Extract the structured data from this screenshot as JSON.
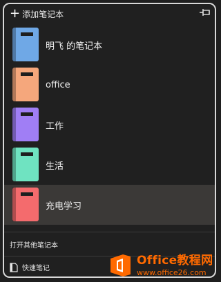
{
  "header": {
    "add_label": "添加笔记本"
  },
  "notebooks": [
    {
      "label": "明飞 的笔记本",
      "color": "#6fa8e6"
    },
    {
      "label": "office",
      "color": "#f5a77c"
    },
    {
      "label": "工作",
      "color": "#a07ef5"
    },
    {
      "label": "生活",
      "color": "#6fe3c1"
    },
    {
      "label": "充电学习",
      "color": "#f46b6d"
    }
  ],
  "selected_index": 4,
  "footer": {
    "open_other": "打开其他笔记本",
    "quick_notes": "快速笔记"
  },
  "watermark": {
    "main": "Office教程网",
    "sub": "www.office26.com"
  }
}
